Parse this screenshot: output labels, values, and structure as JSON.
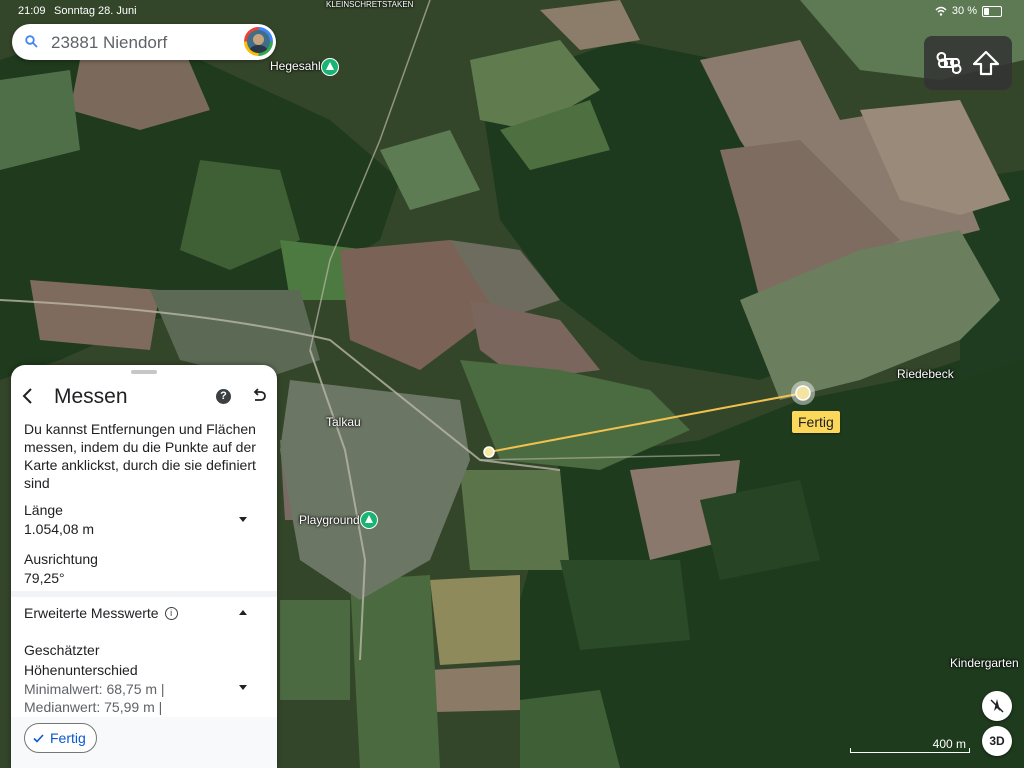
{
  "status": {
    "time": "21:09",
    "date": "Sonntag 28. Juni",
    "battery": "30 %"
  },
  "search": {
    "query": "23881 Niendorf",
    "icon": "search-icon"
  },
  "map": {
    "labels": [
      {
        "text": "KLEINSCHRETSTAKEN"
      },
      {
        "text": "Hegesahl"
      },
      {
        "text": "Talkau"
      },
      {
        "text": "Playground"
      },
      {
        "text": "Riedebeck"
      },
      {
        "text": "Kindergarten"
      }
    ],
    "measure_tag": "Fertig",
    "scale": "400 m",
    "view_3d": "3D",
    "colors": {
      "measure_line": "#f2c14e",
      "pin": "#19b374",
      "tag": "#fbd85a"
    }
  },
  "keyboard": {
    "icons": [
      "command-key-icon",
      "shift-key-icon"
    ]
  },
  "panel": {
    "title": "Messen",
    "description": "Du kannst Entfernungen und Flächen messen, indem du die Punkte auf der Karte anklickst, durch die sie definiert sind",
    "length_label": "Länge",
    "length_value": "1.054,08 m",
    "orientation_label": "Ausrichtung",
    "orientation_value": "79,25°",
    "advanced_label": "Erweiterte Messwerte",
    "elevation_label_1": "Geschätzter",
    "elevation_label_2": "Höhenunterschied",
    "elevation_min": "Minimalwert: 68,75 m |",
    "elevation_median": "Medianwert: 75,99 m |",
    "done_label": "Fertig"
  }
}
